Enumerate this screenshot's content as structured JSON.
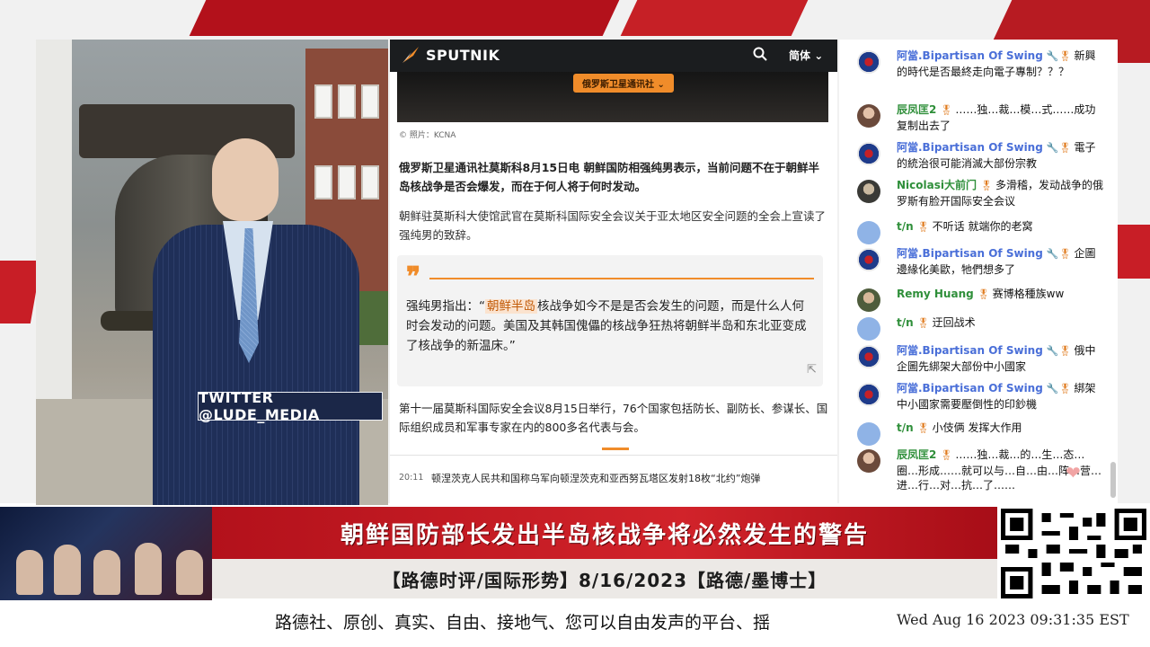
{
  "video": {
    "twitter_label": "TWITTER  @LUDE_MEDIA"
  },
  "article": {
    "brand": "SPUTNIK",
    "search_icon": "search-icon",
    "lang_label": "简体",
    "photo_badge": "俄罗斯卫星通讯社",
    "photo_caption": "© 照片：KCNA",
    "lead": "俄罗斯卫星通讯社莫斯科8月15日电 朝鲜国防相强纯男表示，当前问题不在于朝鲜半岛核战争是否会爆发，而在于何人将于何时发动。",
    "para2": "朝鲜驻莫斯科大使馆武官在莫斯科国际安全会议关于亚太地区安全问题的全会上宣读了强纯男的致辞。",
    "quote_prefix": "强纯男指出：“",
    "quote_highlight": "朝鲜半岛",
    "quote_rest": "核战争如今不是是否会发生的问题，而是什么人何时会发动的问题。美国及其韩国傀儡的核战争狂热将朝鲜半岛和东北亚变成了核战争的新温床。”",
    "para3": "第十一届莫斯科国际安全会议8月15日举行，76个国家包括防长、副防长、参谋长、国际组织成员和军事专家在内的800多名代表与会。",
    "ticker_time": "20:11",
    "ticker_text": "顿涅茨克人民共和国称乌军向顿涅茨克和亚西努瓦塔区发射18枚“北约”炮弹"
  },
  "chat": {
    "messages": [
      {
        "name": "阿當.Bipartisan Of Swing",
        "icons": "🔧🎖",
        "text": "新興的時代是否最終走向電子專制？？？"
      },
      {
        "name": "辰凤匡2",
        "icons": "🎖",
        "text": "……独…裁…模…式……成功复制出去了"
      },
      {
        "name": "阿當.Bipartisan Of Swing",
        "icons": "🔧🎖",
        "text": "電子的統治很可能消滅大部份宗教"
      },
      {
        "name": "Nicolasi大前门",
        "icons": "🎖",
        "text": "多滑稽，发动战争的俄罗斯有脸开国际安全会议"
      },
      {
        "name": "t/n",
        "icons": "🎖",
        "text": "不听话 就端你的老窝"
      },
      {
        "name": "阿當.Bipartisan Of Swing",
        "icons": "🔧🎖",
        "text": "企圖邊緣化美歐，牠們想多了"
      },
      {
        "name": "Remy Huang",
        "icons": "🎖",
        "text": "赛博格種族ww"
      },
      {
        "name": "t/n",
        "icons": "🎖",
        "text": "迂回战术"
      },
      {
        "name": "阿當.Bipartisan Of Swing",
        "icons": "🔧🎖",
        "text": "俄中企圖先綁架大部份中小國家"
      },
      {
        "name": "阿當.Bipartisan Of Swing",
        "icons": "🔧🎖",
        "text": "綁架中小國家需要壓倒性的印鈔機"
      },
      {
        "name": "t/n",
        "icons": "🎖",
        "text": "小伎俩 发挥大作用"
      },
      {
        "name": "辰凤匡2",
        "icons": "🎖",
        "text": "……独…裁…的…生…态…圈…形成……就可以与…自…由…阵…营…进…行…对…抗…了……"
      }
    ]
  },
  "banner": {
    "title": "朝鲜国防部长发出半岛核战争将必然发生的警告",
    "subtitle": "【路德时评/国际形势】8/16/2023【路德/墨博士】"
  },
  "footer": {
    "marquee": "路德社、原创、真实、自由、接地气、您可以自由发声的平台、揺",
    "clock": "Wed Aug 16 2023 09:31:35 EST"
  },
  "colors": {
    "brand_red": "#b3111b",
    "accent_orange": "#f08c2a",
    "chat_name_blue": "#4a6fd8",
    "chat_name_green": "#2f8f3a"
  }
}
